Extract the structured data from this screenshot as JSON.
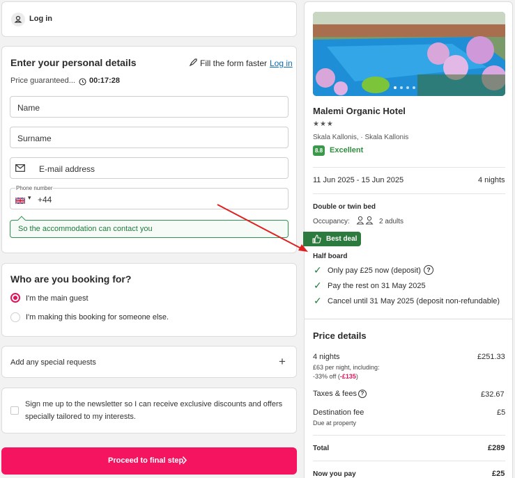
{
  "login_bar": {
    "label": "Log in"
  },
  "personal": {
    "title": "Enter your personal details",
    "fill_faster": "Fill the form faster",
    "login_link": "Log in",
    "price_guaranteed": "Price guaranteed...",
    "timer": "00:17:28",
    "name_placeholder": "Name",
    "surname_placeholder": "Surname",
    "email_placeholder": "E-mail address",
    "phone_label": "Phone number",
    "phone_code": "+44",
    "contact_hint": "So the accommodation can contact you"
  },
  "booking_for": {
    "title": "Who are you booking for?",
    "option_main": "I'm the main guest",
    "option_other": "I'm making this booking for someone else."
  },
  "special_requests": {
    "label": "Add any special requests",
    "icon": "+"
  },
  "newsletter": {
    "text": "Sign me up to the newsletter so I can receive exclusive discounts and offers specially tailored to my interests."
  },
  "proceed": {
    "label": "Proceed to final step",
    "color": "#f5145f"
  },
  "hotel": {
    "name": "Malemi Organic Hotel",
    "stars": "★★★",
    "location": "Skala Kallonis, · Skala Kallonis",
    "score": "8.8",
    "rating_text": "Excellent",
    "dates": "11 Jun 2025 - 15 Jun 2025",
    "nights": "4 nights",
    "room_type": "Double or twin bed",
    "occupancy_label": "Occupancy:",
    "occupancy_value": "2 adults",
    "badge": "Best deal",
    "board": "Half board",
    "perks": [
      "Only pay £25 now (deposit)",
      "Pay the rest on 31 May 2025",
      "Cancel until 31 May 2025 (deposit non-refundable)"
    ]
  },
  "price": {
    "title": "Price details",
    "nights_label": "4 nights",
    "nights_amount": "£251.33",
    "per_night": "£63 per night, including:",
    "discount_prefix": "-33% off (",
    "discount_value": "-£135",
    "discount_suffix": ")",
    "taxes_label": "Taxes & fees",
    "taxes_amount": "£32.67",
    "dest_label": "Destination fee",
    "dest_amount": "£5",
    "dest_note": "Due at property",
    "total_label": "Total",
    "total_amount": "£289",
    "now_label": "Now you pay",
    "now_amount": "£25"
  }
}
